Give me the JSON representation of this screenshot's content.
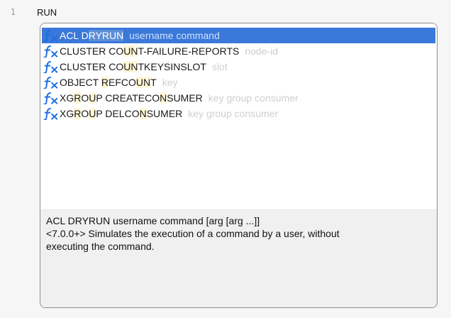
{
  "editor": {
    "line_number": "1",
    "line_text": "RUN"
  },
  "suggestions": [
    {
      "name": "ACL DRYRUN",
      "args": "username command",
      "selected": true,
      "icon": "function-icon"
    },
    {
      "name": "CLUSTER COUNT-FAILURE-REPORTS",
      "args": "node-id",
      "selected": false,
      "icon": "function-icon"
    },
    {
      "name": "CLUSTER COUNTKEYSINSLOT",
      "args": "slot",
      "selected": false,
      "icon": "function-icon"
    },
    {
      "name": "OBJECT REFCOUNT",
      "args": "key",
      "selected": false,
      "icon": "function-icon"
    },
    {
      "name": "XGROUP CREATECONSUMER",
      "args": "key group consumer",
      "selected": false,
      "icon": "function-icon"
    },
    {
      "name": "XGROUP DELCONSUMER",
      "args": "key group consumer",
      "selected": false,
      "icon": "function-icon"
    }
  ],
  "details": {
    "line1": "ACL DRYRUN username command [arg [arg ...]]",
    "line2": "<7.0.0+> Simulates the execution of a command by a user, without",
    "line3": "executing the command."
  },
  "colors": {
    "selection": "#3a78da",
    "match_highlight": "#fff7d7",
    "fx_icon": "#1e6fe0"
  }
}
